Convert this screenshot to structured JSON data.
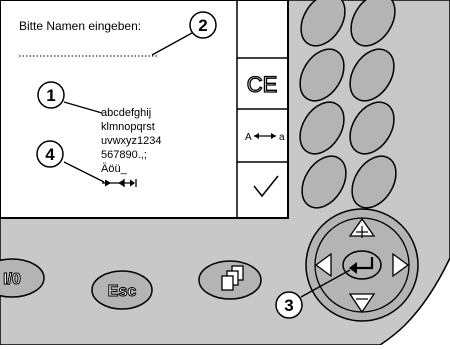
{
  "screen": {
    "prompt": "Bitte Namen eingeben:",
    "character_rows": [
      "abcdefghij",
      "klmnopqrst",
      "uvwxyz1234",
      "567890.,;",
      "Äöü_"
    ]
  },
  "softkeys": [
    {
      "id": "ce",
      "label": "CE",
      "icon": "clear-entry-icon"
    },
    {
      "id": "case",
      "label_left": "A",
      "label_right": "a",
      "icon": "case-toggle-icon"
    },
    {
      "id": "ok",
      "label": "",
      "icon": "checkmark-icon"
    }
  ],
  "hardkeys": {
    "power": "I/0",
    "esc": "Esc",
    "menu": "",
    "enter": ""
  },
  "callouts": [
    "1",
    "2",
    "3",
    "4"
  ],
  "colors": {
    "housing": "#c8c8c8",
    "key_fill": "#b4b4b4",
    "screen": "#ffffff",
    "outline": "#000000"
  }
}
